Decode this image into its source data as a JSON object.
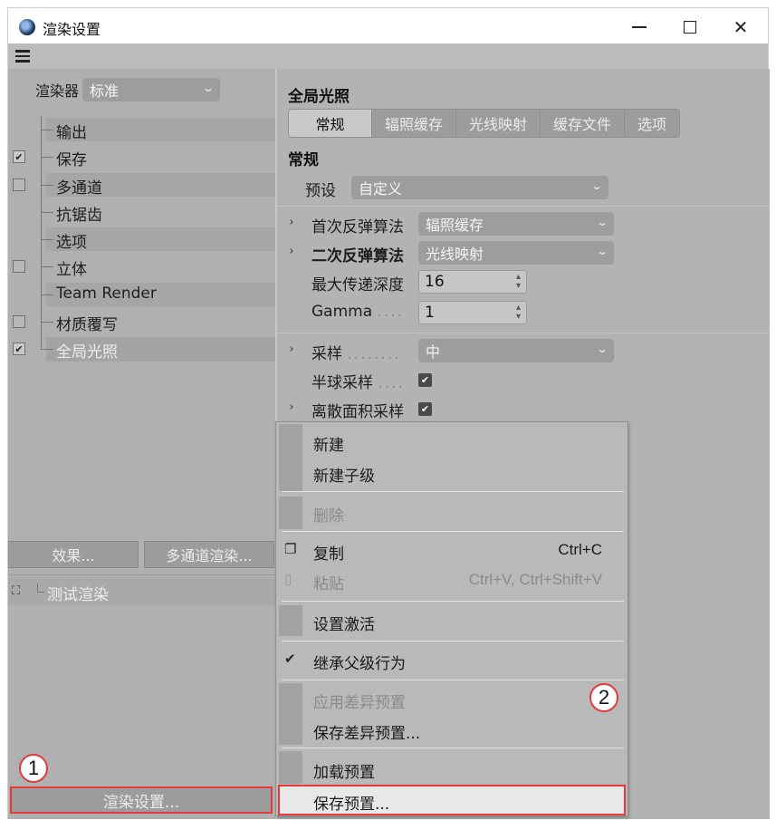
{
  "window": {
    "title": "渲染设置",
    "min_icon": "minimize-icon",
    "max_icon": "maximize-icon",
    "close_glyph": "✕"
  },
  "left": {
    "renderer_label": "渲染器",
    "renderer_value": "标准",
    "tree": [
      {
        "label": "输出",
        "check": null,
        "striped": true
      },
      {
        "label": "保存",
        "check": true,
        "striped": false
      },
      {
        "label": "多通道",
        "check": false,
        "striped": true
      },
      {
        "label": "抗锯齿",
        "check": null,
        "striped": false
      },
      {
        "label": "选项",
        "check": null,
        "striped": true
      },
      {
        "label": "立体",
        "check": false,
        "striped": false
      },
      {
        "label": "Team Render",
        "check": null,
        "striped": true
      },
      {
        "label": "材质覆写",
        "check": false,
        "striped": false
      },
      {
        "label": "全局光照",
        "check": true,
        "striped": false,
        "selected": true
      }
    ],
    "effects_button": "效果...",
    "multipass_button": "多通道渲染...",
    "test_render_label": "测试渲染",
    "render_settings_button": "渲染设置...",
    "badge_1": "1"
  },
  "right": {
    "section_title": "全局光照",
    "tabs": [
      "常规",
      "辐照缓存",
      "光线映射",
      "缓存文件",
      "选项"
    ],
    "active_tab": 0,
    "group_title": "常规",
    "preset_label": "预设",
    "preset_value": "自定义",
    "primary_label": "首次反弹算法",
    "primary_value": "辐照缓存",
    "secondary_label": "二次反弹算法",
    "secondary_value": "光线映射",
    "depth_label": "最大传递深度",
    "depth_value": "16",
    "gamma_label": "Gamma",
    "gamma_dots": "....",
    "gamma_value": "1",
    "sampling_label": "采样",
    "sampling_dots": "........",
    "sampling_value": "中",
    "hemi_label": "半球采样",
    "hemi_dots": "....",
    "discrete_label": "离散面积采样"
  },
  "context_menu": {
    "items": {
      "new": "新建",
      "new_child": "新建子级",
      "delete": "删除",
      "copy": "复制",
      "copy_shortcut": "Ctrl+C",
      "paste": "粘贴",
      "paste_shortcut": "Ctrl+V, Ctrl+Shift+V",
      "set_active": "设置激活",
      "inherit": "继承父级行为",
      "apply_diff": "应用差异预置",
      "save_diff": "保存差异预置...",
      "load_preset": "加载预置",
      "save_preset": "保存预置..."
    },
    "badge_2": "2"
  },
  "colors": {
    "highlight_border": "#e23b3b",
    "panel_bg": "#b2b2b2"
  }
}
